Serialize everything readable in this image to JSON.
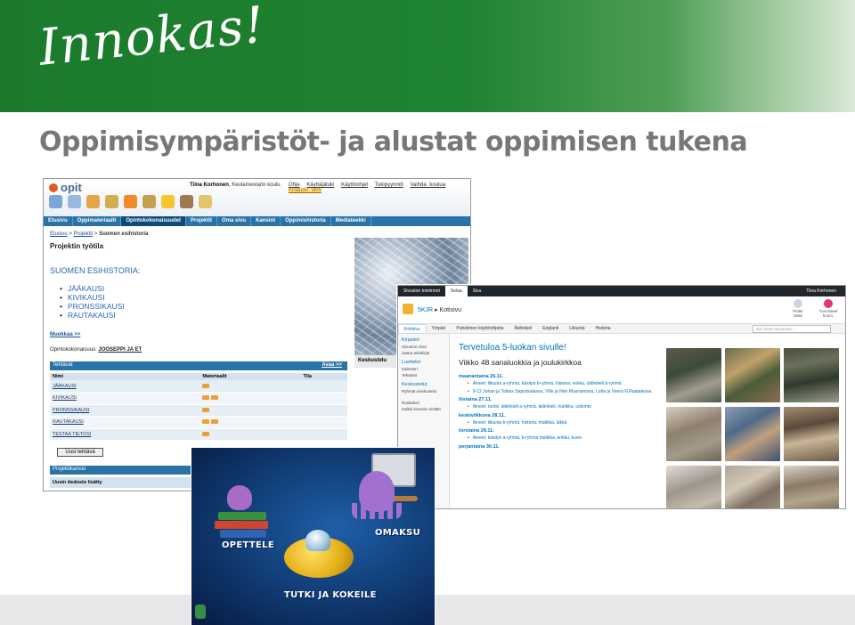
{
  "slide": {
    "brand": "Innokas!",
    "title": "Oppimisympäristöt- ja alustat oppimisen tukena"
  },
  "opit": {
    "logo": "opit",
    "user_name": "Tiina Korhonen",
    "user_school": "Keulamestarin koulu",
    "top_links": [
      "Ohje",
      "Käyttäjätuki",
      "Käyttöohjet",
      "Tukipyynnöt",
      "Vaihda koulua",
      "Kirjaudu ulos"
    ],
    "nav": [
      "Etusivu",
      "Oppimateriaalit",
      "Opintokokonaisuudet",
      "Projektit",
      "Oma sivu",
      "Kansiot",
      "Oppimishistoria",
      "Mediateekki"
    ],
    "nav_active": "Opintokokonaisuudet",
    "breadcrumb": [
      "Etusivu",
      "Projektit",
      "Suomen esihistoria"
    ],
    "heading": "Projektin työtila",
    "subject": "SUOMEN ESIHISTORIA:",
    "periods": [
      "JÄÄKAUSI",
      "KIVIKAUSI",
      "PRONSSIKAUSI",
      "RAUTAKAUSI"
    ],
    "edit_link": "Muokkaa >>",
    "assignment_label": "Opintokokonaisuus:",
    "assignment_value": "JOOSEPPI JA ET",
    "tasks_title": "Tehtävät",
    "tasks_open": "Avaa >>",
    "task_columns": [
      "Nimi",
      "Materiaalit",
      "Tila"
    ],
    "tasks": [
      "JÄÄKAUSI",
      "KIVIKAUSI",
      "PRONSSIKAUSI",
      "RAUTAKAUSI",
      "TESTAA TIETOSI"
    ],
    "new_task_button": "Uusi tehtävä",
    "folder_title": "Projektikansio",
    "folder_row": "Uusin tiedosto lisätty",
    "side_panel": "Keskustelu"
  },
  "sharepoint": {
    "ribbon": [
      "Sivuston toiminnot",
      "Selaa",
      "Sivu"
    ],
    "ribbon_active": "Selaa",
    "user": "Tiina Korhonen",
    "site": "5KJR",
    "page": "Kotisivu",
    "tools": [
      "Pidän tästä",
      "Tunnisteet huom."
    ],
    "nav": [
      "Kotisivu",
      "Ympäri",
      "Puhelimen käyttöohjeita",
      "Äidinkieli",
      "Englanti",
      "Liikunta",
      "Historia"
    ],
    "nav_active": "Kotisivu",
    "search_placeholder": "Etsi tästä sivustosta...",
    "left": [
      {
        "h": "Kirjastot",
        "items": [
          "Sivuston sivut",
          "Jaetut asiakirjat"
        ]
      },
      {
        "h": "Luettelot",
        "items": [
          "Kalenteri",
          "Tehtävät"
        ]
      },
      {
        "h": "Keskustelut",
        "items": [
          "Ryhmän keskustelu"
        ]
      },
      {
        "h": "",
        "items": [
          "Roskakori",
          "Kaikki sivuston sisältö"
        ]
      }
    ],
    "welcome": "Tervetuloa 5-luokan sivulle!",
    "week": "Viikko 48 sanaluokkia ja joulukirkkoa",
    "schedule": [
      {
        "day": "maanantaina 26.11.",
        "items": [
          "Aineet: liikunta a-ryhmä, käsityö b-ryhmä, historia, enkku, äidinkieli b-ryhmä",
          "9-12 Johan ja Tobias Sapuskalassa, Ville ja Neri Muurareissa, Lotta ja Veera N.Raatalessa"
        ]
      },
      {
        "day": "tiistaina 27.11.",
        "items": [
          "Aineet: ruotsi, äidinkieli a-ryhmä, äidinkieli, matikka, uskonto"
        ]
      },
      {
        "day": "keskiviikkona 28.11.",
        "items": [
          "Aineet: liikunta b-ryhmä, historia, matikka, äikkä"
        ]
      },
      {
        "day": "torstaina 29.11.",
        "items": [
          "Aineet: käsityö a-ryhmä, b-ryhmä matikka, enkku, kuvis"
        ]
      },
      {
        "day": "perjantaina 30.11.",
        "items": []
      }
    ]
  },
  "game": {
    "labels": [
      "OPETTELE",
      "OMAKSU",
      "TUTKI JA KOKEILE"
    ]
  }
}
